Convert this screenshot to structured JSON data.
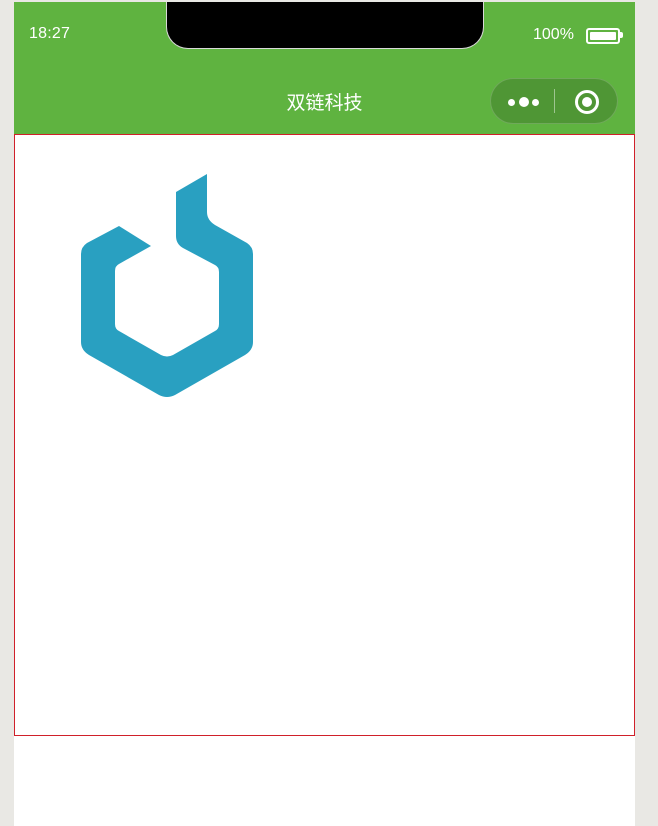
{
  "status_bar": {
    "time": "18:27",
    "battery_percent": "100%",
    "battery_level": 1.0
  },
  "nav_bar": {
    "title": "双链科技",
    "more_icon": "more-dots-icon",
    "close_icon": "target-close-icon"
  },
  "content": {
    "logo_icon": "hexagon-logo-icon",
    "logo_color": "#29a0c1"
  },
  "colors": {
    "header_bg": "#5fb340",
    "frame_border": "#d0202a"
  }
}
